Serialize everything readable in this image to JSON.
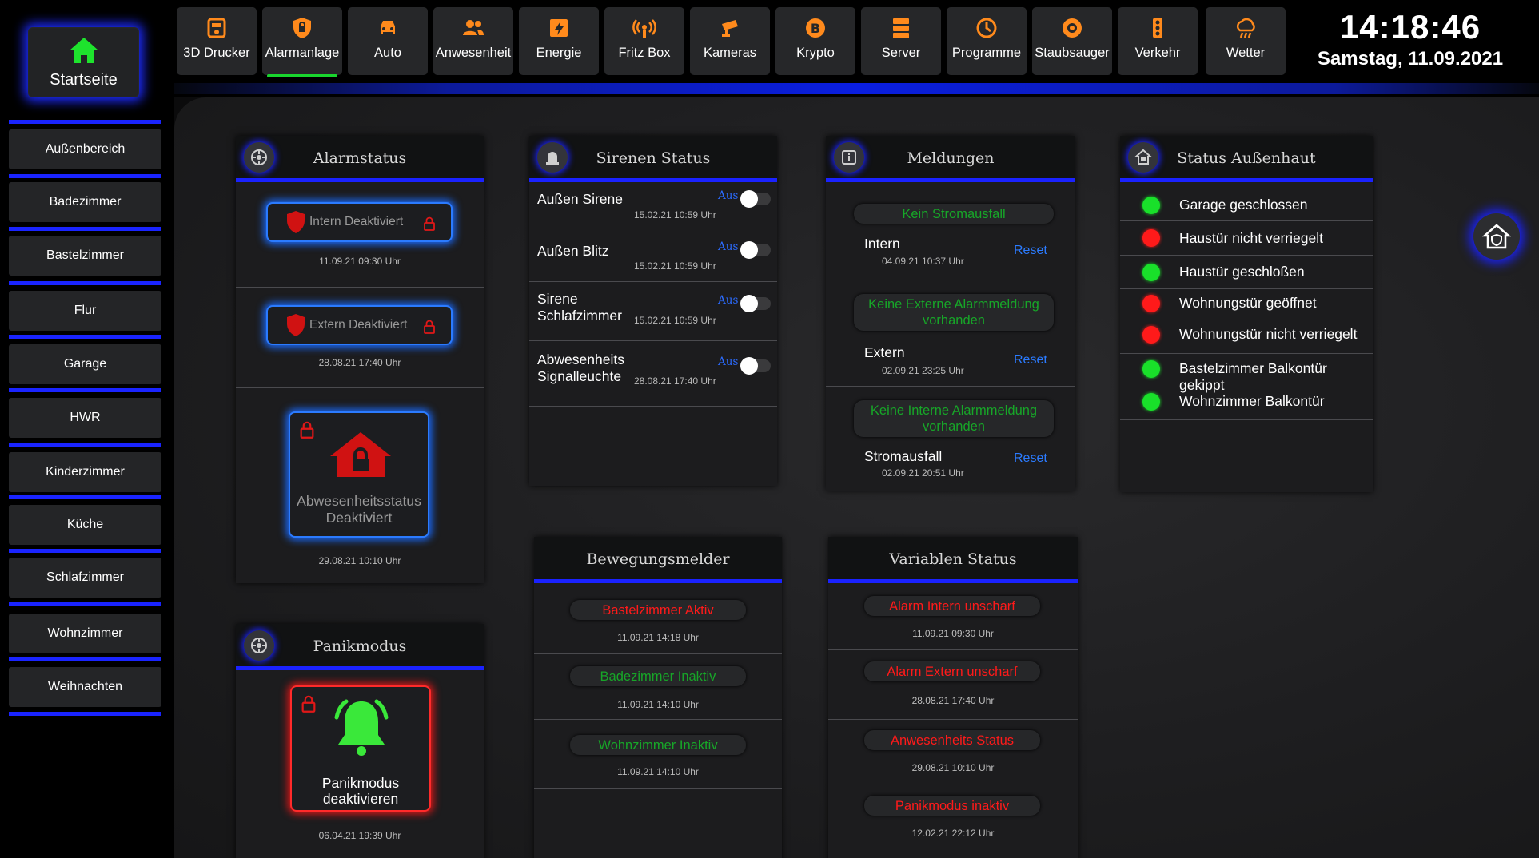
{
  "sidebar": {
    "home_label": "Startseite",
    "items": [
      {
        "label": "Außenbereich"
      },
      {
        "label": "Badezimmer"
      },
      {
        "label": "Bastelzimmer"
      },
      {
        "label": "Flur"
      },
      {
        "label": "Garage"
      },
      {
        "label": "HWR"
      },
      {
        "label": "Kinderzimmer"
      },
      {
        "label": "Küche"
      },
      {
        "label": "Schlafzimmer"
      },
      {
        "label": "Wohnzimmer"
      },
      {
        "label": "Weihnachten"
      }
    ]
  },
  "topnav": {
    "items": [
      {
        "label": "3D Drucker",
        "icon": "printer-icon"
      },
      {
        "label": "Alarmanlage",
        "icon": "shield-icon",
        "active": true
      },
      {
        "label": "Auto",
        "icon": "car-icon"
      },
      {
        "label": "Anwesenheit",
        "icon": "people-icon"
      },
      {
        "label": "Energie",
        "icon": "energy-icon"
      },
      {
        "label": "Fritz Box",
        "icon": "router-icon"
      },
      {
        "label": "Kameras",
        "icon": "camera-icon"
      },
      {
        "label": "Krypto",
        "icon": "bitcoin-icon"
      },
      {
        "label": "Server",
        "icon": "server-icon"
      },
      {
        "label": "Programme",
        "icon": "programs-icon"
      },
      {
        "label": "Staubsauger",
        "icon": "vacuum-icon"
      },
      {
        "label": "Verkehr",
        "icon": "traffic-light-icon"
      },
      {
        "label": "Wetter",
        "icon": "weather-icon"
      }
    ],
    "icon_color": "#ff8a1c",
    "active_color": "#19d62e"
  },
  "clock": {
    "time": "14:18:46",
    "date": "Samstag, 11.09.2021"
  },
  "alarmstatus": {
    "title": "Alarmstatus",
    "intern": {
      "label": "Intern Deaktiviert",
      "ts": "11.09.21 09:30 Uhr"
    },
    "extern": {
      "label": "Extern Deaktiviert",
      "ts": "28.08.21 17:40 Uhr"
    },
    "absence": {
      "label": "Abwesenheitsstatus Deaktiviert",
      "ts": "29.08.21 10:10 Uhr"
    }
  },
  "panik": {
    "title": "Panikmodus",
    "button": "Panikmodus deaktivieren",
    "ts": "06.04.21 19:39 Uhr"
  },
  "sirenen": {
    "title": "Sirenen Status",
    "rows": [
      {
        "label": "Außen Sirene",
        "state": "Aus",
        "ts": "15.02.21 10:59 Uhr"
      },
      {
        "label": "Außen Blitz",
        "state": "Aus",
        "ts": "15.02.21 10:59 Uhr"
      },
      {
        "label": "Sirene Schlafzimmer",
        "state": "Aus",
        "ts": "15.02.21 10:59 Uhr"
      },
      {
        "label": "Abwesenheits Signalleuchte",
        "state": "Aus",
        "ts": "28.08.21 17:40 Uhr"
      }
    ]
  },
  "meldungen": {
    "title": "Meldungen",
    "reset_label": "Reset",
    "rows": [
      {
        "pill": "Kein Stromausfall",
        "label": "Intern",
        "ts": "04.09.21 10:37 Uhr"
      },
      {
        "pill": "Keine Externe Alarmmeldung vorhanden",
        "label": "Extern",
        "ts": "02.09.21 23:25 Uhr"
      },
      {
        "pill": "Keine Interne Alarmmeldung vorhanden",
        "label": "Stromausfall",
        "ts": "02.09.21 20:51 Uhr"
      }
    ]
  },
  "aussenhaut": {
    "title": "Status Außenhaut",
    "rows": [
      {
        "label": "Garage geschlossen",
        "color": "#19e02a"
      },
      {
        "label": "Haustür nicht verriegelt",
        "color": "#ff1a1a"
      },
      {
        "label": "Haustür geschloßen",
        "color": "#19e02a"
      },
      {
        "label": "Wohnungstür geöffnet",
        "color": "#ff1a1a"
      },
      {
        "label": "Wohnungstür nicht verriegelt",
        "color": "#ff1a1a"
      },
      {
        "label": "Bastelzimmer Balkontür gekippt",
        "color": "#19e02a"
      },
      {
        "label": "Wohnzimmer Balkontür",
        "color": "#19e02a"
      }
    ]
  },
  "bewegung": {
    "title": "Bewegungsmelder",
    "rows": [
      {
        "label": "Bastelzimmer Aktiv",
        "ts": "11.09.21 14:18 Uhr",
        "color": "#ff1a1a"
      },
      {
        "label": "Badezimmer Inaktiv",
        "ts": "11.09.21 14:10 Uhr",
        "color": "#17a628"
      },
      {
        "label": "Wohnzimmer Inaktiv",
        "ts": "11.09.21 14:10 Uhr",
        "color": "#17a628"
      }
    ]
  },
  "variablen": {
    "title": "Variablen Status",
    "rows": [
      {
        "label": "Alarm Intern unscharf",
        "ts": "11.09.21 09:30 Uhr"
      },
      {
        "label": "Alarm Extern unscharf",
        "ts": "28.08.21 17:40 Uhr"
      },
      {
        "label": "Anwesenheits Status",
        "ts": "29.08.21 10:10 Uhr"
      },
      {
        "label": "Panikmodus inaktiv",
        "ts": "12.02.21 22:12 Uhr"
      }
    ]
  },
  "colors": {
    "accent_blue": "#1a22ff",
    "green": "#19e02a",
    "red": "#ff1a1a",
    "link_blue": "#2b7bff",
    "orange": "#ff8a1c"
  }
}
